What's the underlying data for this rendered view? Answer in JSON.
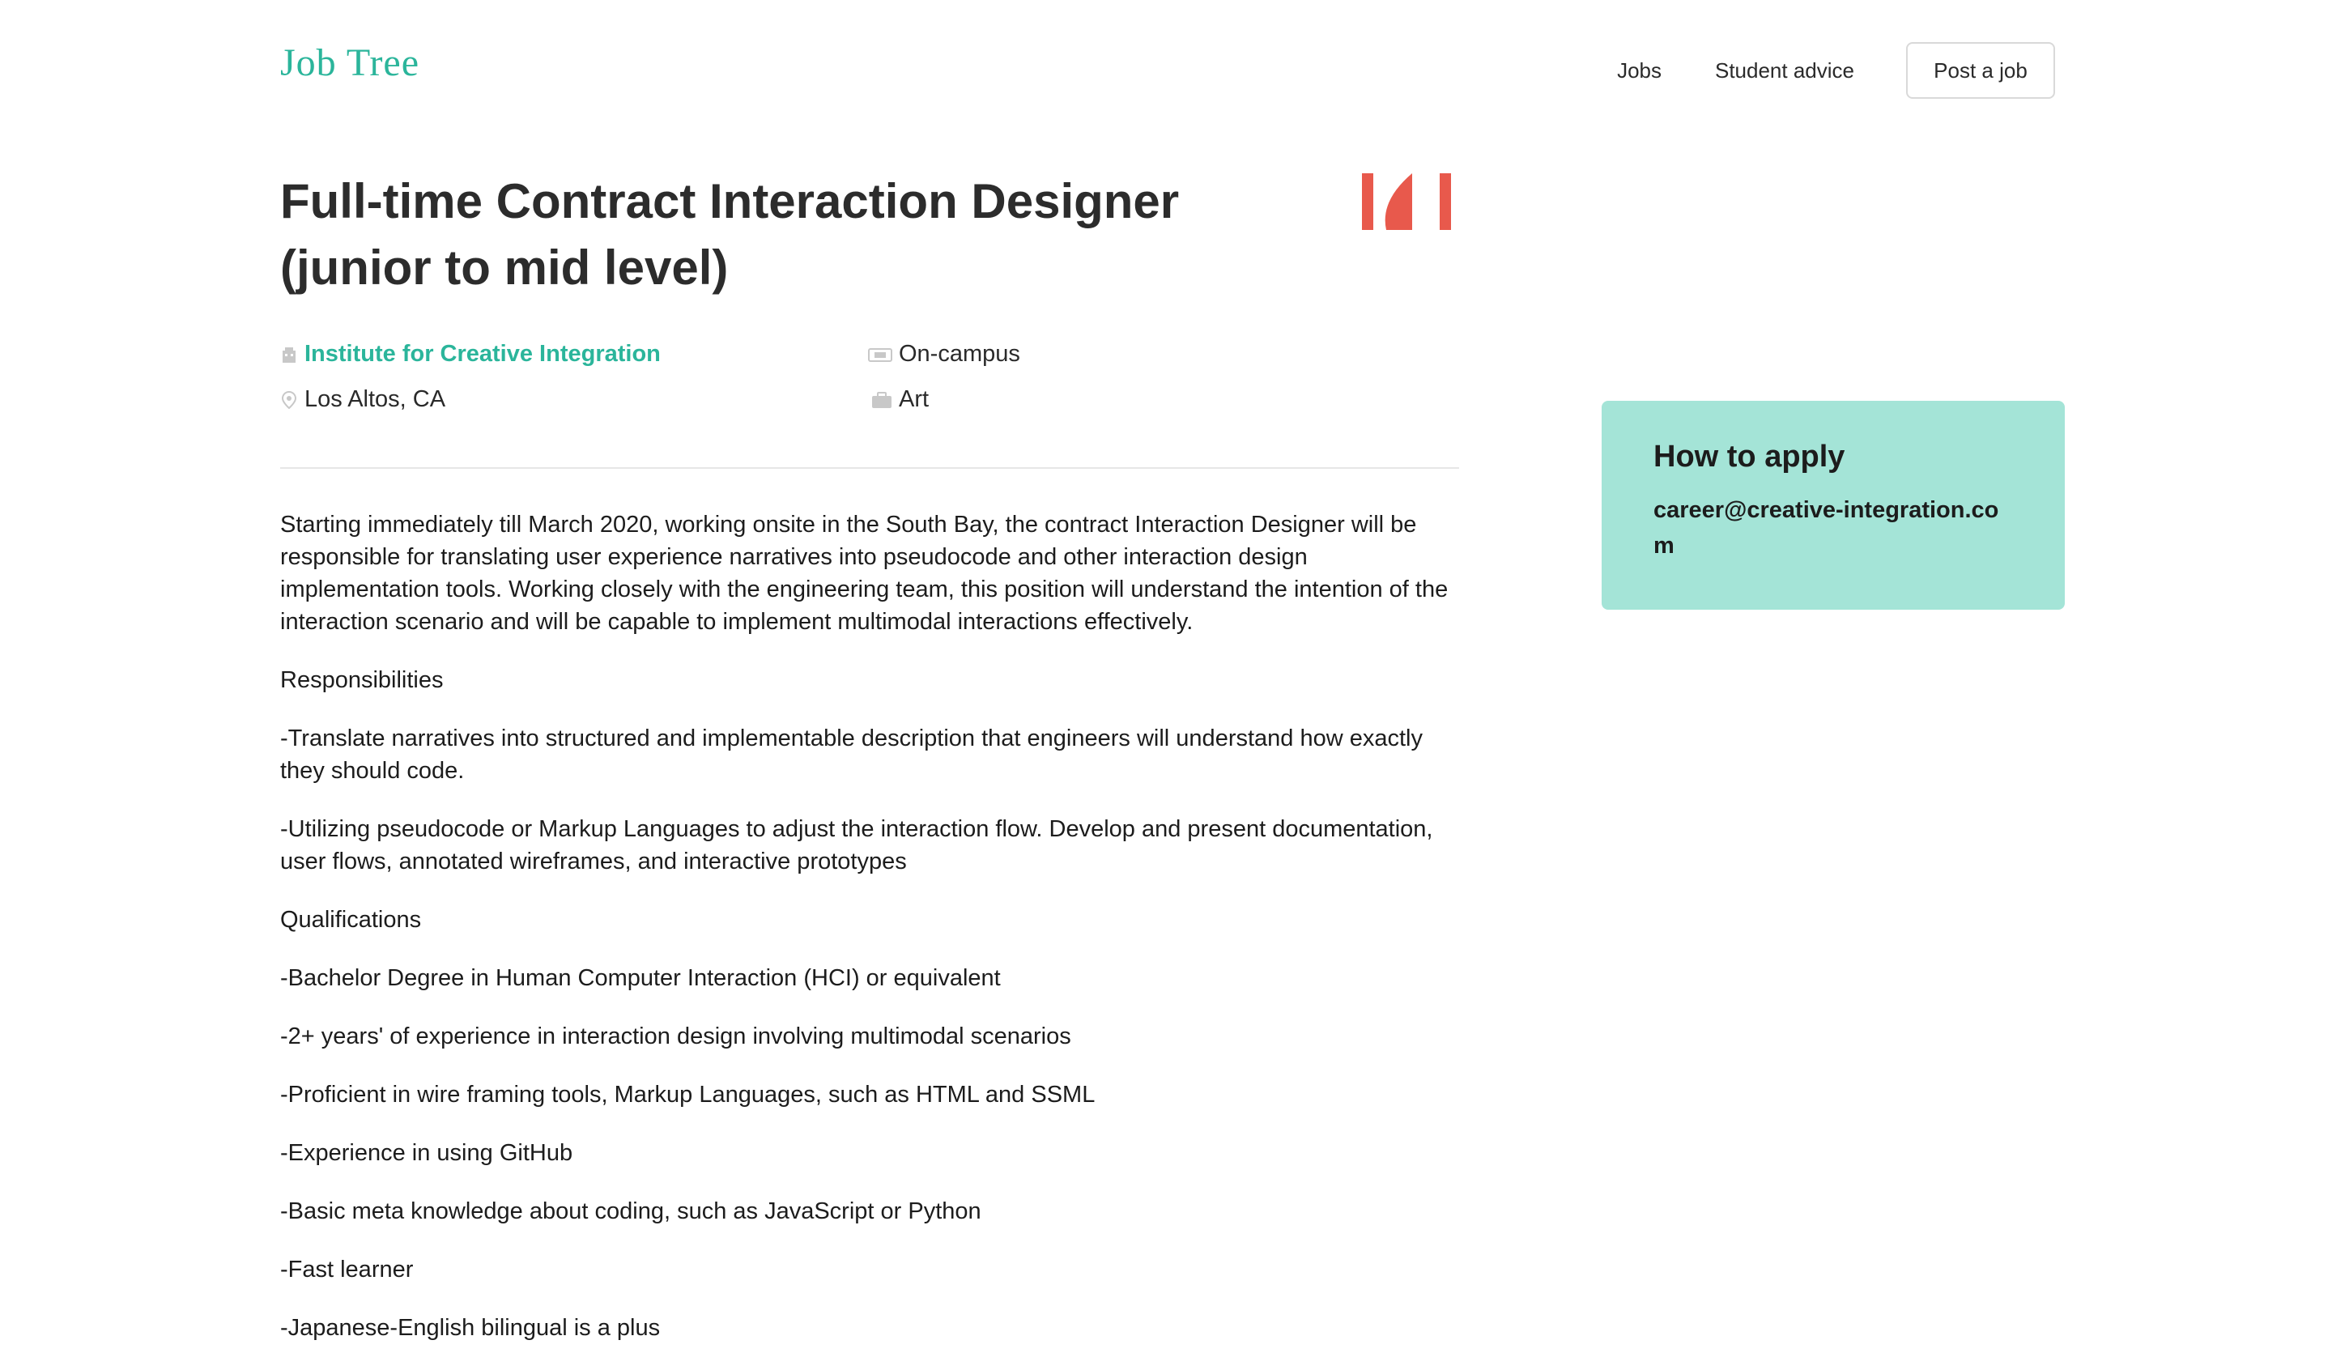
{
  "header": {
    "logo": "Job Tree",
    "nav": [
      {
        "label": "Jobs"
      },
      {
        "label": "Student advice"
      }
    ],
    "post_button": "Post a job"
  },
  "job": {
    "title": "Full-time Contract Interaction Designer (junior to mid level)",
    "company_logo_text": "ICI",
    "company": "Institute for Creative Integration",
    "location": "Los Altos, CA",
    "workplace": "On-campus",
    "category": "Art",
    "description": [
      "Starting immediately till March 2020, working onsite in the South Bay, the contract Interaction Designer will be responsible for translating user experience narratives into pseudocode and other interaction design implementation tools. Working closely with the engineering team, this position will understand the intention of the interaction scenario and will be capable to implement multimodal interactions effectively.",
      "Responsibilities",
      "-Translate narratives into structured and implementable description that engineers will understand how exactly they should code.",
      "-Utilizing pseudocode or Markup Languages to adjust the interaction flow. Develop and present documentation, user flows, annotated wireframes, and interactive prototypes",
      "Qualifications",
      "-Bachelor Degree in Human Computer Interaction (HCI) or equivalent",
      "-2+ years' of experience in interaction design involving multimodal scenarios",
      "-Proficient in wire framing tools, Markup Languages, such as HTML and SSML",
      "-Experience in using GitHub",
      "-Basic meta knowledge about coding, such as JavaScript or Python",
      "-Fast learner",
      "-Japanese-English bilingual is a plus"
    ]
  },
  "apply": {
    "title": "How to apply",
    "email": "career@creative-integration.com"
  },
  "colors": {
    "brand": "#2bb59b",
    "apply_bg": "#a4e4d7",
    "logo_red": "#e8594c",
    "icon_gray": "#c8c8c8"
  },
  "icons": {
    "company": "building-icon",
    "location": "map-pin-icon",
    "workplace": "money-icon",
    "category": "briefcase-icon"
  }
}
